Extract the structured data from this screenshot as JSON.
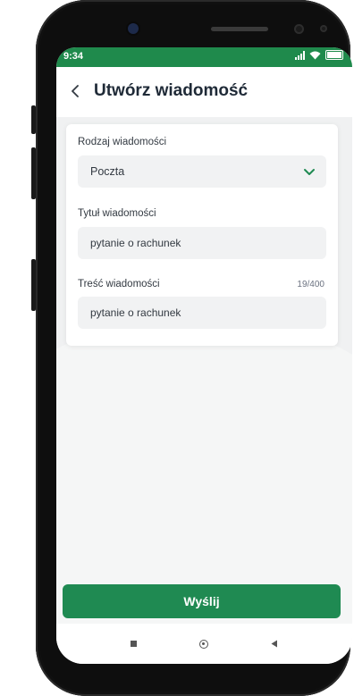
{
  "status_bar": {
    "time": "9:34"
  },
  "header": {
    "title": "Utwórz wiadomość"
  },
  "form": {
    "type_label": "Rodzaj wiadomości",
    "type_value": "Poczta",
    "subject_label": "Tytuł wiadomości",
    "subject_value": "pytanie o rachunek",
    "body_label": "Treść wiadomości",
    "body_counter": "19/400",
    "body_value": "pytanie o rachunek"
  },
  "actions": {
    "send_label": "Wyślij"
  },
  "colors": {
    "accent": "#1f8a52",
    "status_bar": "#1f8a4c"
  },
  "icons": [
    "back-chevron-icon",
    "dropdown-chevron-icon",
    "signal-icon",
    "wifi-icon",
    "battery-icon",
    "nav-recents-icon",
    "nav-home-icon",
    "nav-back-icon"
  ]
}
